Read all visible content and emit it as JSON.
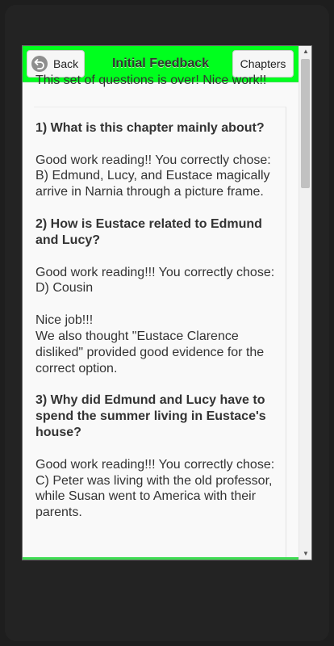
{
  "header": {
    "back_label": "Back",
    "title": "Initial Feedback",
    "chapters_label": "Chapters",
    "back_icon": "back-arrow-icon"
  },
  "feedback": {
    "intro": "This set of questions is over! Nice work!!",
    "q1": {
      "question": "1) What is this chapter mainly about?",
      "response": "Good work reading!! You correctly chose: B) Edmund, Lucy, and Eustace magically arrive in Narnia through a picture frame."
    },
    "q2": {
      "question": "2) How is Eustace related to Edmund and Lucy?",
      "response": "Good work reading!!! You correctly chose: D) Cousin",
      "praise": "Nice job!!!",
      "evidence": "We also thought \"Eustace Clarence disliked\" provided good evidence for the correct option."
    },
    "q3": {
      "question": "3) Why did Edmund and Lucy have to spend the summer living in Eustace's house?",
      "response": "Good work reading!!! You correctly chose: C) Peter was living with the old professor, while Susan went to America with their parents."
    }
  },
  "scrollbar": {
    "up_arrow": "▲",
    "down_arrow": "▼"
  },
  "colors": {
    "header_bg": "#00ff1e",
    "frame_bg": "#1e1e1e"
  }
}
